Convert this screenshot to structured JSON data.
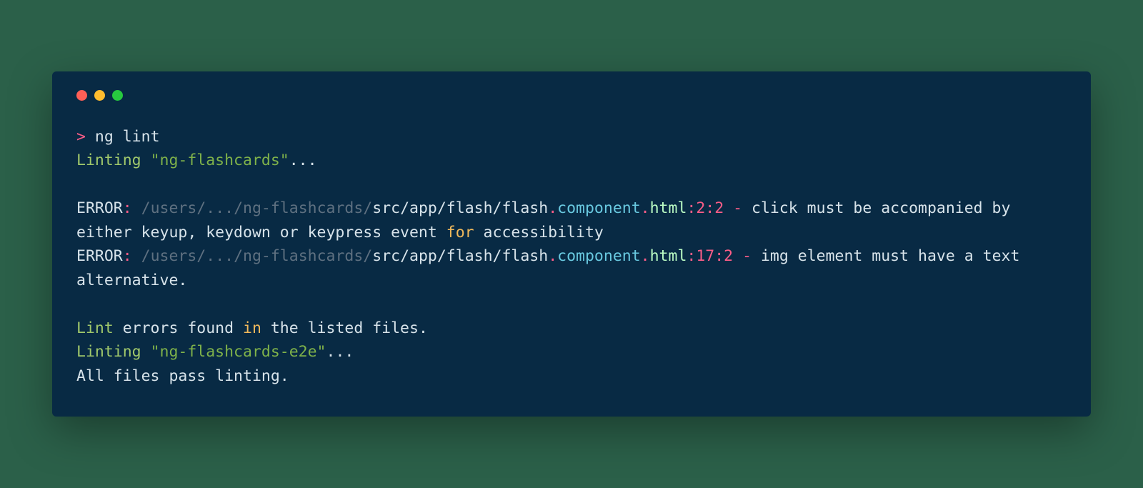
{
  "prompt": {
    "symbol": ">",
    "command": "ng lint"
  },
  "linting1": {
    "word": "Linting",
    "project": "\"ng-flashcards\"",
    "ellipsis": "..."
  },
  "error1": {
    "label": "ERROR",
    "colon": ":",
    "path_dim": "/users/.../ng-flashcards/",
    "path": "src/app/flash/flash",
    "dot1": ".",
    "component": "component",
    "dot2": ".",
    "ext": "html",
    "lc": ":2:2",
    "sep": " - ",
    "msg_before": "click must be accompanied by either keyup, keydown or keypress event ",
    "kw": "for",
    "msg_after": " accessibility"
  },
  "error2": {
    "label": "ERROR",
    "colon": ":",
    "path_dim": "/users/.../ng-flashcards/",
    "path": "src/app/flash/flash",
    "dot1": ".",
    "component": "component",
    "dot2": ".",
    "ext": "html",
    "lc": ":17:2",
    "sep": " - ",
    "msg_before": "img element must have a ",
    "alt": "text alternative",
    "msg_after": "."
  },
  "summary": {
    "lint_word": "Lint",
    "before_in": " errors found ",
    "kw": "in",
    "after_in": " the listed files."
  },
  "linting2": {
    "word": "Linting",
    "project": "\"ng-flashcards-e2e\"",
    "ellipsis": "..."
  },
  "pass": {
    "text": "All files pass linting."
  }
}
